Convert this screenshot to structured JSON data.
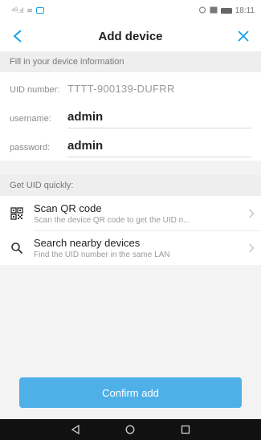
{
  "status_bar": {
    "signal": "⁴ᴳ.ıl",
    "wifi": "≋",
    "time": "18:11"
  },
  "nav": {
    "title": "Add device",
    "back_icon": "chevron-left-icon",
    "close_icon": "close-icon"
  },
  "form": {
    "section_label": "Fill in your device information",
    "uid_label": "UID number:",
    "uid_value": "TTTT-900139-DUFRR",
    "username_label": "username:",
    "username_value": "admin",
    "password_label": "password:",
    "password_value": "admin"
  },
  "quick": {
    "section_label": "Get UID quickly:",
    "items": [
      {
        "icon": "qr-code-icon",
        "title": "Scan QR code",
        "subtitle": "Scan the device QR code to get the UID n..."
      },
      {
        "icon": "search-icon",
        "title": "Search nearby devices",
        "subtitle": "Find the UID number in the same LAN"
      }
    ]
  },
  "confirm_label": "Confirm add",
  "colors": {
    "accent": "#1aa0e6",
    "confirm_bg": "#4fb0e8"
  }
}
